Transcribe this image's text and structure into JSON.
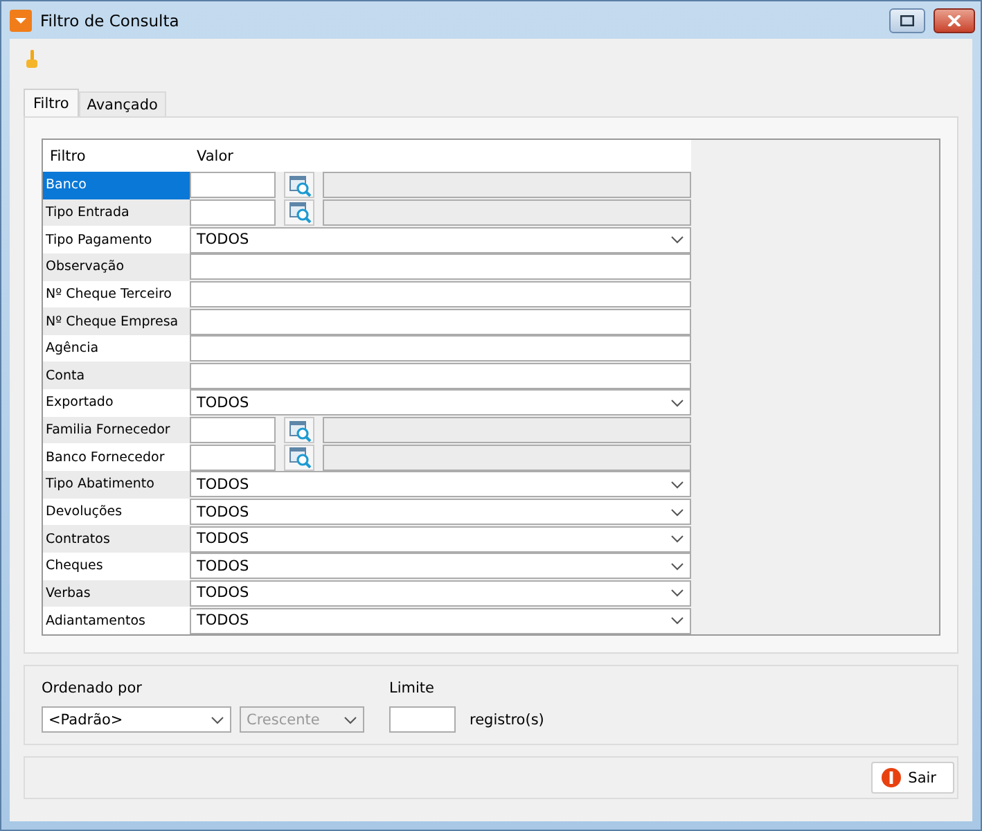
{
  "window": {
    "title": "Filtro de Consulta"
  },
  "tabs": [
    {
      "label": "Filtro",
      "selected": true
    },
    {
      "label": "Avançado",
      "selected": false
    }
  ],
  "grid": {
    "columns": [
      "Filtro",
      "Valor"
    ],
    "rows": [
      {
        "label": "Banco",
        "kind": "lookup",
        "selected": true
      },
      {
        "label": "Tipo Entrada",
        "kind": "lookup",
        "selected": false
      },
      {
        "label": "Tipo Pagamento",
        "kind": "select",
        "value": "TODOS",
        "selected": false
      },
      {
        "label": "Observação",
        "kind": "text",
        "selected": false
      },
      {
        "label": "Nº Cheque Terceiro",
        "kind": "text",
        "selected": false
      },
      {
        "label": "Nº Cheque Empresa",
        "kind": "text",
        "selected": false
      },
      {
        "label": "Agência",
        "kind": "text",
        "selected": false
      },
      {
        "label": "Conta",
        "kind": "text",
        "selected": false
      },
      {
        "label": "Exportado",
        "kind": "select",
        "value": "TODOS",
        "selected": false
      },
      {
        "label": "Familia Fornecedor",
        "kind": "lookup",
        "selected": false
      },
      {
        "label": "Banco Fornecedor",
        "kind": "lookup",
        "selected": false
      },
      {
        "label": "Tipo Abatimento",
        "kind": "select",
        "value": "TODOS",
        "selected": false
      },
      {
        "label": "Devoluções",
        "kind": "select",
        "value": "TODOS",
        "selected": false
      },
      {
        "label": "Contratos",
        "kind": "select",
        "value": "TODOS",
        "selected": false
      },
      {
        "label": "Cheques",
        "kind": "select",
        "value": "TODOS",
        "selected": false
      },
      {
        "label": "Verbas",
        "kind": "select",
        "value": "TODOS",
        "selected": false
      },
      {
        "label": "Adiantamentos",
        "kind": "select",
        "value": "TODOS",
        "selected": false
      }
    ]
  },
  "order": {
    "label": "Ordenado por",
    "field": {
      "value": "<Padrão>",
      "disabled": false
    },
    "direction": {
      "value": "Crescente",
      "disabled": true
    }
  },
  "limit": {
    "label": "Limite",
    "unit": "registro(s)"
  },
  "footer": {
    "exit_button": "Sair"
  }
}
